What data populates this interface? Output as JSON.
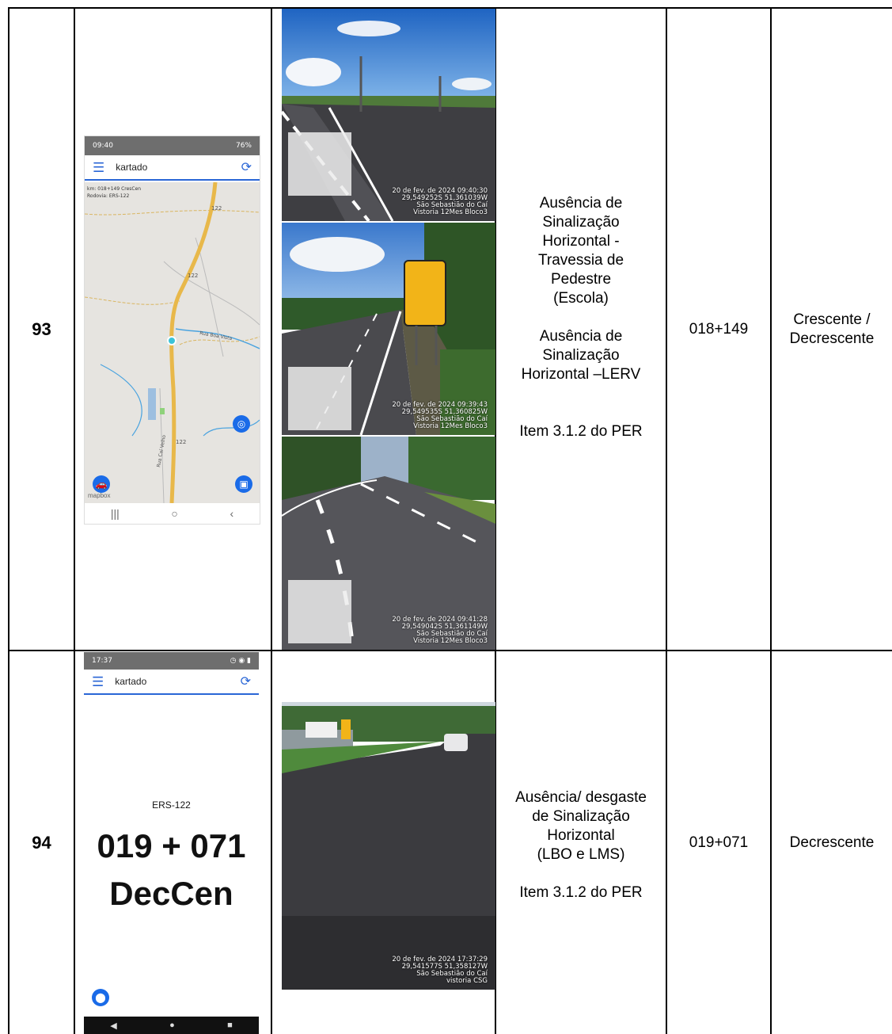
{
  "rows": [
    {
      "number": "93",
      "phone": {
        "status_time": "09:40",
        "status_right": "76%",
        "app_title": "kartado",
        "km_label": "km: 018+149 CresCen",
        "road_label": "Rodovia: ERS-122",
        "map_labels": [
          "122",
          "122",
          "122",
          "Rua Boa Vista",
          "Rua Caí Velho"
        ],
        "map_brand": "mapbox"
      },
      "photos": [
        {
          "stamp": "20 de fev. de 2024 09:40:30\n29,549252S 51,361039W\nSão Sebastião do Caí\nVistoria 12Mes Bloco3"
        },
        {
          "stamp": "20 de fev. de 2024 09:39:43\n29,549535S 51,360825W\nSão Sebastião do Caí\nVistoria 12Mes Bloco3"
        },
        {
          "stamp": "20 de fev. de 2024 09:41:28\n29,549042S 51,361149W\nSão Sebastião do Caí\nVistoria 12Mes Bloco3"
        }
      ],
      "description": "Ausência de\nSinalização\nHorizontal -\nTravessia de\nPedestre\n(Escola)\n\nAusência de\nSinalização\nHorizontal –LERV\n\n\nItem 3.1.2 do PER",
      "km": "018+149",
      "direction": "Crescente /\nDecrescente"
    },
    {
      "number": "94",
      "phone": {
        "status_time": "17:37",
        "app_title": "kartado",
        "road": "ERS-122",
        "km_big": "019 + 071",
        "dir_big": "DecCen"
      },
      "photos": [
        {
          "stamp": "20 de fev. de 2024 17:37:29\n29,541577S 51,358127W\nSão Sebastião do Caí\nvistoria CSG"
        }
      ],
      "description": "Ausência/ desgaste\nde Sinalização\nHorizontal\n(LBO e LMS)\n\nItem 3.1.2 do PER",
      "km": "019+071",
      "direction": "Decrescente"
    }
  ],
  "colors": {
    "accent": "#2a66d6",
    "road_yellow": "#e8b84a",
    "fab_blue": "#1a6be8"
  }
}
